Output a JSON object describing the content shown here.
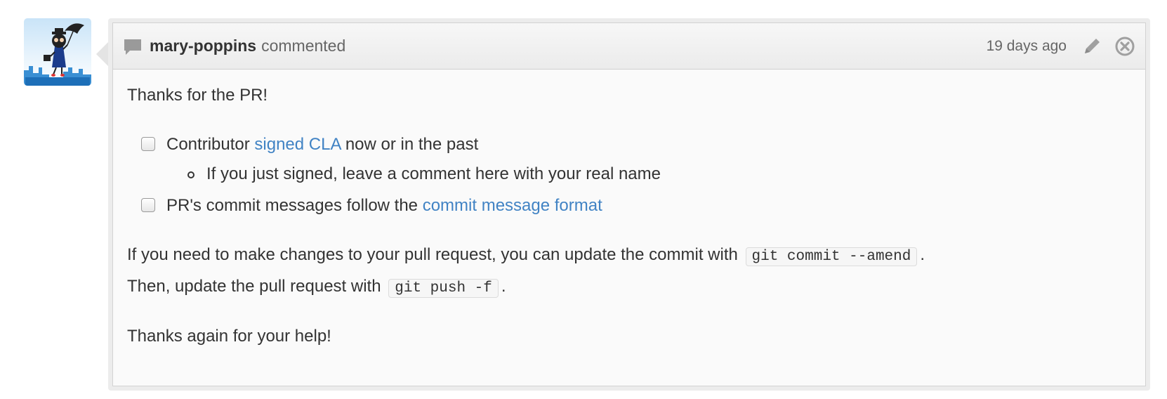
{
  "avatar": {
    "icon": "octocat-avatar"
  },
  "header": {
    "author": "mary-poppins",
    "action": "commented",
    "timestamp": "19 days ago",
    "comment_icon": "speech-bubble-icon",
    "edit_icon": "pencil-icon",
    "delete_icon": "close-circle-icon"
  },
  "body": {
    "intro": "Thanks for the PR!",
    "tasks": [
      {
        "before": "Contributor ",
        "link": "signed CLA",
        "after": " now or in the past",
        "checked": false,
        "subitems": [
          "If you just signed, leave a comment here with your real name"
        ]
      },
      {
        "before": "PR's commit messages follow the ",
        "link": "commit message format",
        "after": "",
        "checked": false
      }
    ],
    "amend": {
      "line1_before": "If you need to make changes to your pull request, you can update the commit with ",
      "code1": "git commit --amend",
      "line1_after": ".",
      "line2_before": "Then, update the pull request with ",
      "code2": "git push -f",
      "line2_after": "."
    },
    "outro": "Thanks again for your help!"
  },
  "colors": {
    "link": "#4183c4",
    "text": "#333333",
    "meta": "#666666"
  }
}
